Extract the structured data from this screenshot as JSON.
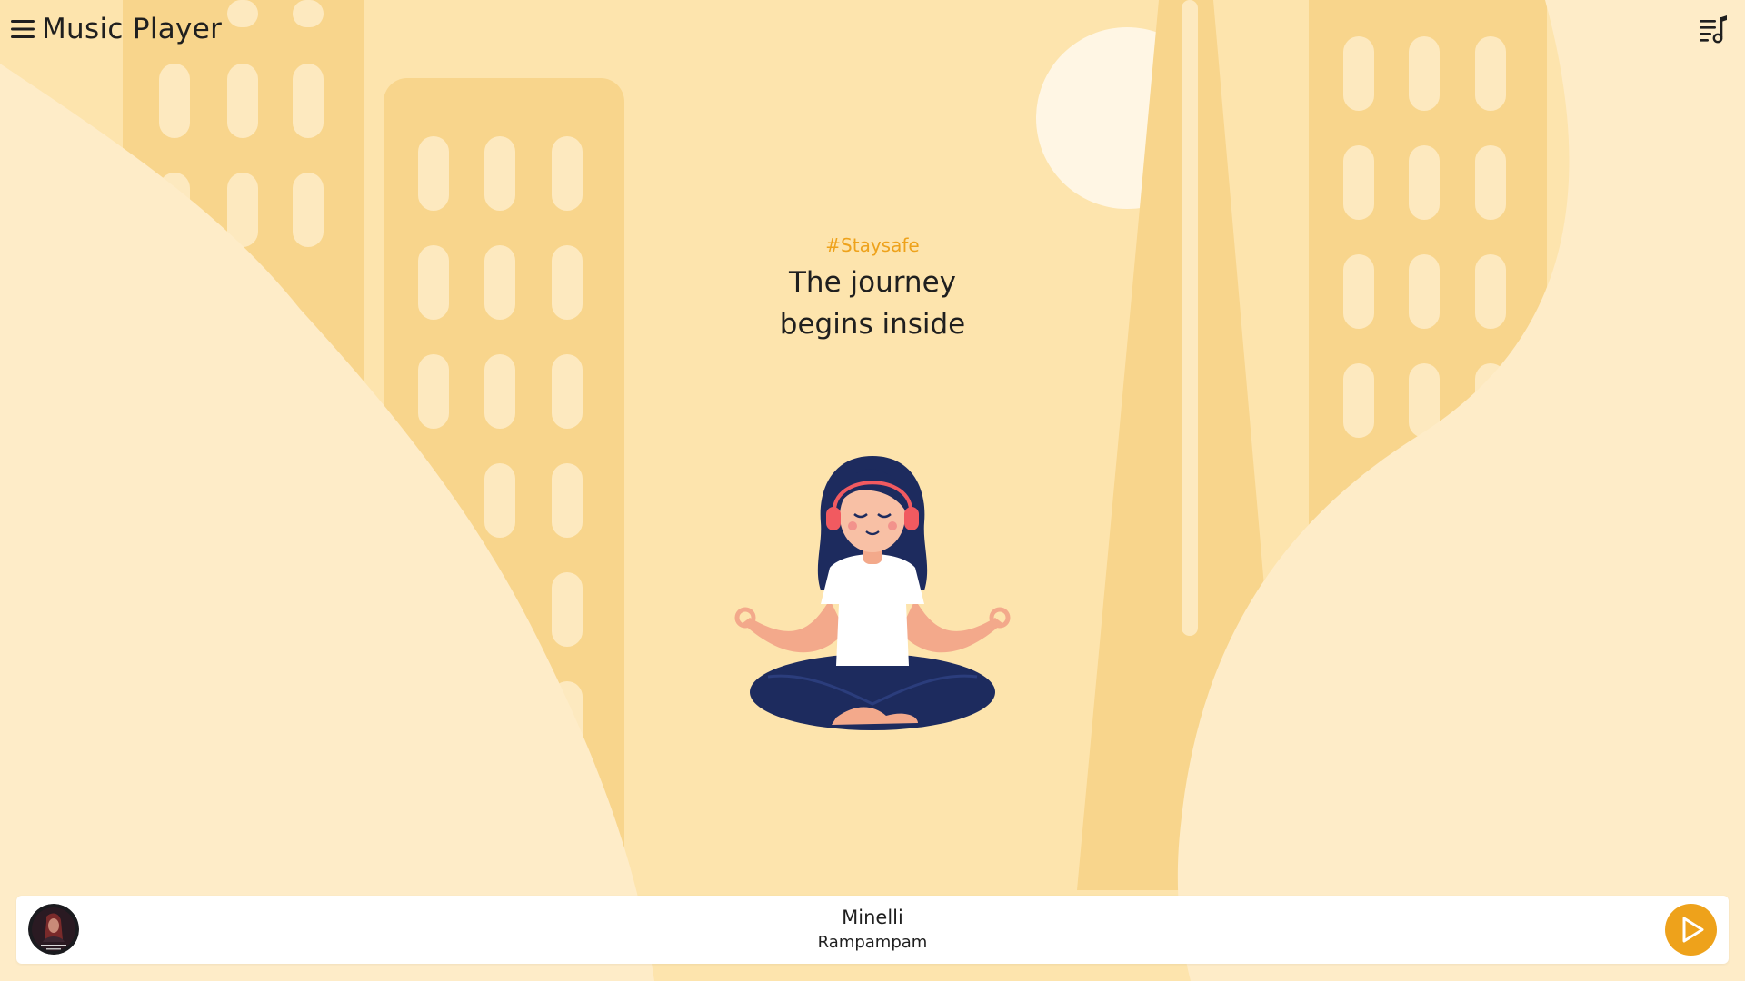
{
  "header": {
    "title": "Music Player",
    "menu_icon": "hamburger-menu-icon",
    "playlist_icon": "music-playlist-icon"
  },
  "hero": {
    "hashtag": "#Staysafe",
    "tagline_line1": "The journey",
    "tagline_line2": "begins inside"
  },
  "illustration": "meditating-woman-with-headphones",
  "player": {
    "track_title": "Minelli",
    "track_artist": "Rampampam",
    "album_art": "album-cover-thumbnail",
    "play_icon": "play-icon"
  },
  "colors": {
    "background": "#fde4ad",
    "accent": "#eea21b",
    "building": "#f8d58c",
    "light_wave": "#feecc8",
    "text": "#1f1f1f",
    "player_bg": "#ffffff"
  }
}
